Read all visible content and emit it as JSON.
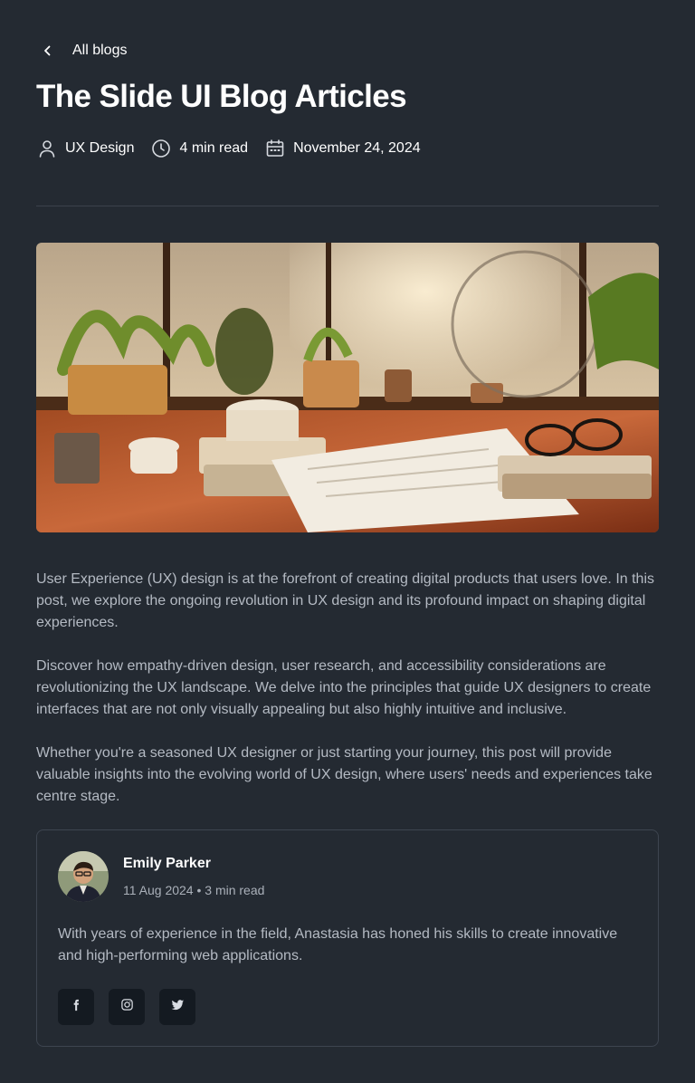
{
  "nav": {
    "back_label": "All blogs"
  },
  "article": {
    "title": "The Slide UI Blog Articles",
    "meta": {
      "category": "UX Design",
      "read_time": "4 min read",
      "date": "November 24, 2024"
    },
    "paragraphs": [
      "User Experience (UX) design is at the forefront of creating digital products that users love. In this post, we explore the ongoing revolution in UX design and its profound impact on shaping digital experiences.",
      "Discover how empathy-driven design, user research, and accessibility considerations are revolutionizing the UX landscape. We delve into the principles that guide UX designers to create interfaces that are not only visually appealing but also highly intuitive and inclusive.",
      "Whether you're a seasoned UX designer or just starting your journey, this post will provide valuable insights into the evolving world of UX design, where users' needs and experiences take centre stage."
    ]
  },
  "author": {
    "name": "Emily Parker",
    "meta": "11 Aug 2024 • 3 min read",
    "bio": "With years of experience in the field, Anastasia has honed his skills to create innovative and high-performing web applications.",
    "socials": [
      {
        "icon": "facebook-icon"
      },
      {
        "icon": "instagram-icon"
      },
      {
        "icon": "twitter-icon"
      }
    ]
  },
  "colors": {
    "background": "#242a32",
    "text": "#ffffff",
    "muted_text": "#b4bac3",
    "border": "#3e4550",
    "social_bg": "#141a21"
  }
}
